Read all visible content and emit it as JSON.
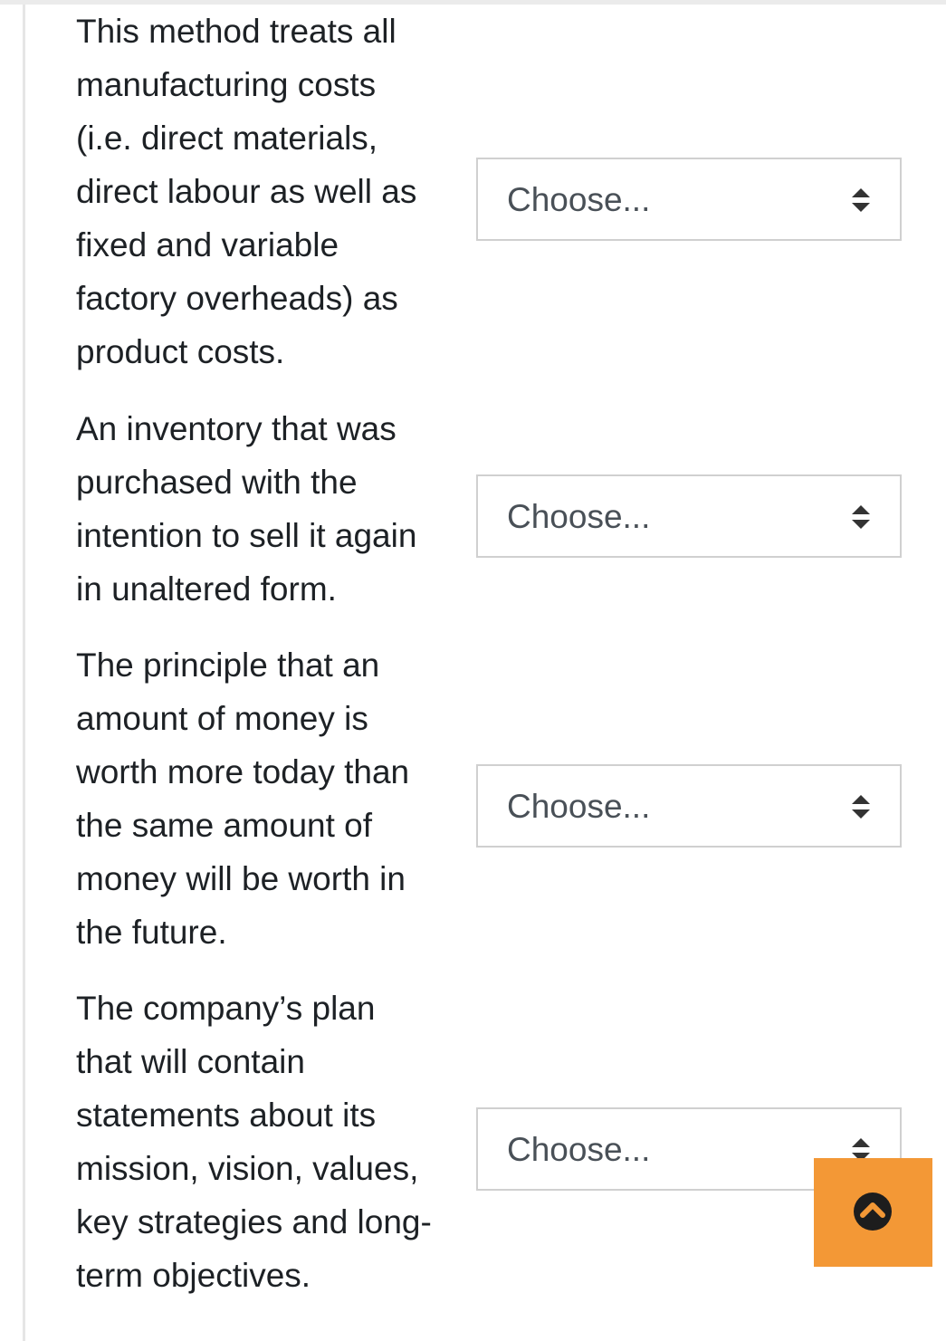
{
  "questions": [
    {
      "text": "This method treats all\nmanufacturing costs\n(i.e. direct materials,\ndirect labour as well as\nfixed and variable\nfactory overheads) as\nproduct costs.",
      "select_value": "Choose..."
    },
    {
      "text": "An inventory that was\npurchased with the\nintention to sell it again\nin unaltered form.",
      "select_value": "Choose..."
    },
    {
      "text": "The principle that an\namount of money is\nworth more today than\nthe same amount of\nmoney will be worth in\nthe future.",
      "select_value": "Choose..."
    },
    {
      "text": "The company’s plan\nthat will contain\nstatements about its\nmission, vision, values,\nkey strategies and long-\nterm objectives.",
      "select_value": "Choose..."
    }
  ],
  "colors": {
    "text": "#1d2125",
    "select_text": "#495057",
    "select_border": "#d0d0d0",
    "scroll_button": "#f39836"
  },
  "icons": {
    "select_arrows": "up-down-caret-icon",
    "scroll_top": "circle-chevron-up-icon"
  }
}
